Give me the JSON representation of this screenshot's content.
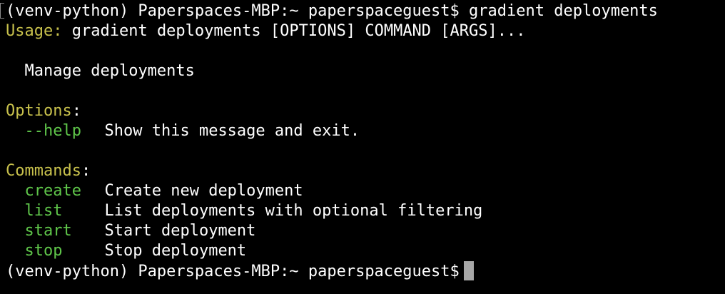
{
  "prompt": {
    "text": "(venv-python) Paperspaces-MBP:~ paperspaceguest$",
    "command": "gradient deployments"
  },
  "usage": {
    "label": "Usage",
    "colon": ":",
    "text": "gradient deployments [OPTIONS] COMMAND [ARGS]..."
  },
  "description": "Manage deployments",
  "options": {
    "heading": "Options",
    "colon": ":",
    "items": [
      {
        "name": "--help",
        "desc": "Show this message and exit."
      }
    ]
  },
  "commands": {
    "heading": "Commands",
    "colon": ":",
    "items": [
      {
        "name": "create",
        "desc": "Create new deployment"
      },
      {
        "name": "list",
        "desc": "List deployments with optional filtering"
      },
      {
        "name": "start",
        "desc": "Start deployment"
      },
      {
        "name": "stop",
        "desc": "Stop deployment"
      }
    ]
  },
  "final_prompt": {
    "text": "(venv-python) Paperspaces-MBP:~ paperspaceguest$"
  },
  "colors": {
    "background": "#000000",
    "text": "#ffffff",
    "heading": "#c8c14c",
    "command": "#5fc64a",
    "cursor": "#a6a6a6"
  }
}
